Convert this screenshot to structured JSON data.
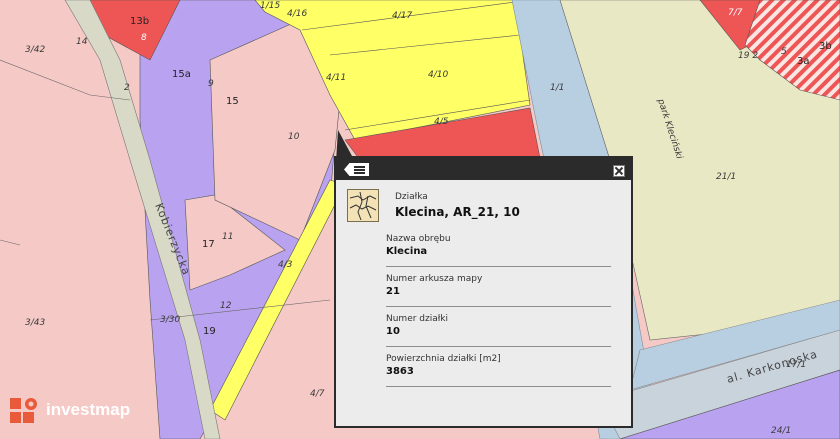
{
  "map": {
    "colors": {
      "residential": "#f5c9c6",
      "service": "#b9a3f0",
      "yellow": "#ffff66",
      "red": "#ee5555",
      "park": "#e9e8c4",
      "water": "#b8cfe2",
      "road": "#c9c9c9"
    },
    "parcel_labels": [
      "13b",
      "8",
      "1/15",
      "4/16",
      "4/17",
      "4/11",
      "4/10",
      "1/1",
      "7/7",
      "3/42",
      "14",
      "15a",
      "9",
      "15",
      "2",
      "10",
      "4/5",
      "19 2",
      "5",
      "3b",
      "3a",
      "11",
      "17",
      "4/3",
      "21/1",
      "3/43",
      "3/30",
      "12",
      "19",
      "4/7",
      "17/1",
      "24/1"
    ],
    "street_labels": [
      "Kobierzycka",
      "park Kleciński",
      "al. Karkonoska"
    ]
  },
  "popup": {
    "title_small": "Działka",
    "title": "Klecina, AR_21, 10",
    "fields": [
      {
        "label": "Nazwa obrębu",
        "value": "Klecina"
      },
      {
        "label": "Numer arkusza mapy",
        "value": "21"
      },
      {
        "label": "Numer działki",
        "value": "10"
      },
      {
        "label": "Powierzchnia działki [m2]",
        "value": "3863"
      }
    ]
  },
  "logo": {
    "text": "investmap",
    "accent": "#e85a3a"
  }
}
